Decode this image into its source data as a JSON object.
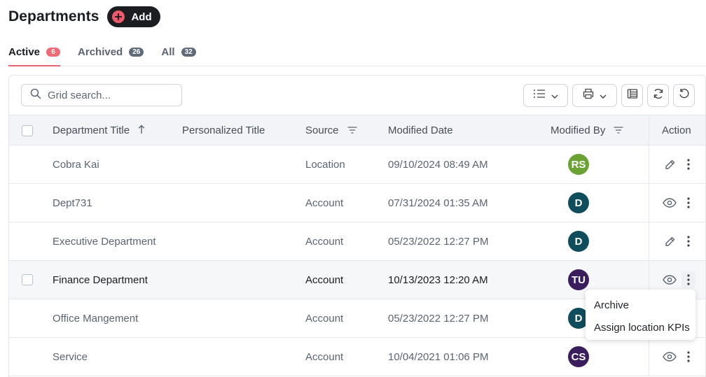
{
  "header": {
    "title": "Departments",
    "add_label": "Add"
  },
  "tabs": [
    {
      "label": "Active",
      "count": "6"
    },
    {
      "label": "Archived",
      "count": "26"
    },
    {
      "label": "All",
      "count": "32"
    }
  ],
  "search": {
    "placeholder": "Grid search..."
  },
  "columns": {
    "title": "Department Title",
    "personalized": "Personalized Title",
    "source": "Source",
    "modified_date": "Modified Date",
    "modified_by": "Modified By",
    "action": "Action"
  },
  "rows": [
    {
      "title": "Cobra Kai",
      "personalized": "",
      "source": "Location",
      "date": "09/10/2024 08:49 AM",
      "initials": "RS",
      "avatar_color": "#6aa334",
      "action_icon": "pencil-icon"
    },
    {
      "title": "Dept731",
      "personalized": "",
      "source": "Account",
      "date": "07/31/2024 01:35 AM",
      "initials": "D",
      "avatar_color": "#0f4c5c",
      "action_icon": "eye-icon"
    },
    {
      "title": "Executive Department",
      "personalized": "",
      "source": "Account",
      "date": "05/23/2022 12:27 PM",
      "initials": "D",
      "avatar_color": "#0f4c5c",
      "action_icon": "pencil-icon"
    },
    {
      "title": "Finance Department",
      "personalized": "",
      "source": "Account",
      "date": "10/13/2023 12:20 AM",
      "initials": "TU",
      "avatar_color": "#3a1d5c",
      "action_icon": "eye-icon"
    },
    {
      "title": "Office Mangement",
      "personalized": "",
      "source": "Account",
      "date": "05/23/2022 12:27 PM",
      "initials": "D",
      "avatar_color": "#0f4c5c",
      "action_icon": "eye-icon"
    },
    {
      "title": "Service",
      "personalized": "",
      "source": "Account",
      "date": "10/04/2021 01:06 PM",
      "initials": "CS",
      "avatar_color": "#3a1d5c",
      "action_icon": "eye-icon"
    }
  ],
  "context_menu": {
    "items": [
      "Archive",
      "Assign location KPIs"
    ]
  },
  "colors": {
    "accent": "#e5656f",
    "add_button": "#1b1d21",
    "add_plus": "#ee5a6a"
  }
}
